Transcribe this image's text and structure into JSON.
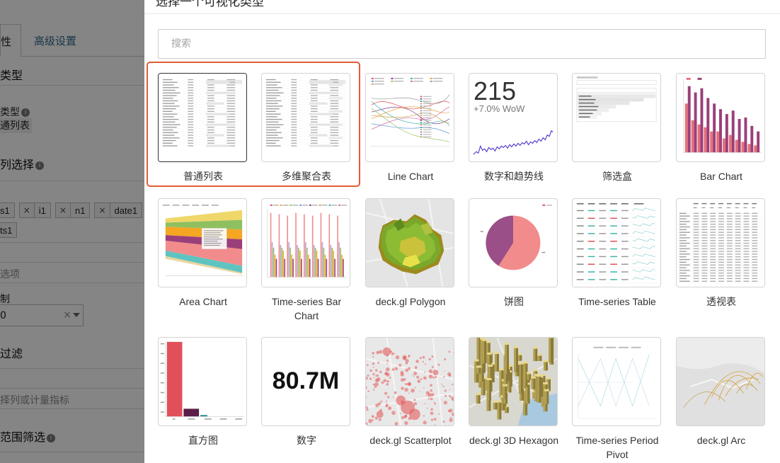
{
  "background_panel": {
    "tab_active": "性",
    "tab_advanced": "高级设置",
    "section_type": "类型",
    "type_label": "类型",
    "type_value": "通列表",
    "section_columns": "列选择",
    "tags_row1": [
      "s1",
      "i1",
      "n1",
      "date1"
    ],
    "tags_row2": [
      "ts1"
    ],
    "options_placeholder": "选项",
    "limit_label": "制",
    "limit_value": "0",
    "section_filter": "过滤",
    "filter_placeholder": "择列或计量指标",
    "section_range": "范围筛选",
    "info_icon_glyph": "i",
    "tag_remove_glyph": "×",
    "select_clear_glyph": "×"
  },
  "modal": {
    "title": "选择一个可视化类型",
    "search_placeholder": "搜索",
    "highlight_color": "#e25c34",
    "tiles": [
      {
        "label": "普通列表",
        "icon": "table-thumbnail"
      },
      {
        "label": "多维聚合表",
        "icon": "pivot-table-thumbnail"
      },
      {
        "label": "Line Chart",
        "icon": "line-chart-thumbnail"
      },
      {
        "label": "数字和趋势线",
        "icon": "big-number-trendline-thumbnail",
        "number": "215",
        "delta": "+7.0% WoW"
      },
      {
        "label": "筛选盒",
        "icon": "filter-box-thumbnail"
      },
      {
        "label": "Bar Chart",
        "icon": "bar-chart-thumbnail"
      },
      {
        "label": "Area Chart",
        "icon": "area-chart-thumbnail"
      },
      {
        "label": "Time-series Bar Chart",
        "icon": "time-series-bar-thumbnail"
      },
      {
        "label": "deck.gl Polygon",
        "icon": "deckgl-polygon-thumbnail"
      },
      {
        "label": "饼图",
        "icon": "pie-chart-thumbnail"
      },
      {
        "label": "Time-series Table",
        "icon": "time-series-table-thumbnail"
      },
      {
        "label": "透视表",
        "icon": "pivot-table-2-thumbnail"
      },
      {
        "label": "直方图",
        "icon": "histogram-thumbnail"
      },
      {
        "label": "数字",
        "icon": "big-number-thumbnail",
        "number": "80.7M"
      },
      {
        "label": "deck.gl Scatterplot",
        "icon": "deckgl-scatterplot-thumbnail"
      },
      {
        "label": "deck.gl 3D Hexagon",
        "icon": "deckgl-3d-hexagon-thumbnail"
      },
      {
        "label": "Time-series Period Pivot",
        "icon": "time-series-period-pivot-thumbnail"
      },
      {
        "label": "deck.gl Arc",
        "icon": "deckgl-arc-thumbnail"
      }
    ]
  }
}
